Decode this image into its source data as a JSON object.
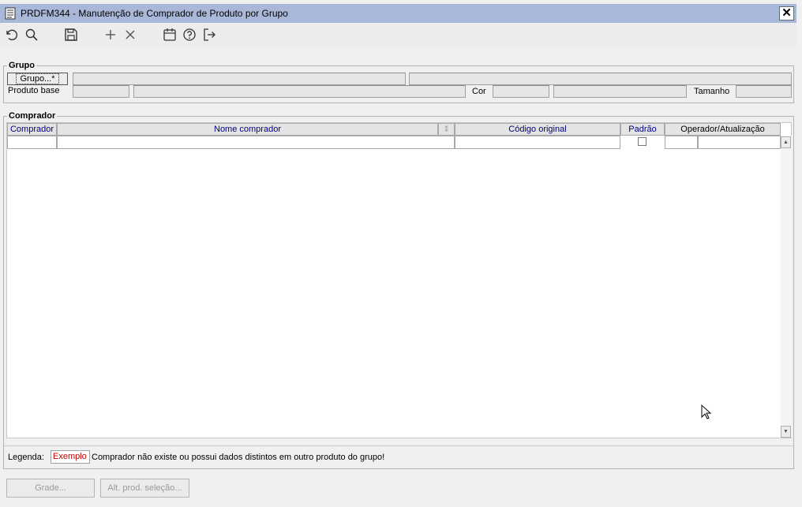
{
  "window": {
    "title": "PRDFM344 - Manutenção de Comprador de Produto por Grupo",
    "close_glyph": "✕"
  },
  "toolbar": {
    "icons": [
      "undo-icon",
      "search-icon",
      "save-icon",
      "add-icon",
      "delete-icon",
      "calendar-icon",
      "help-icon",
      "exit-icon"
    ]
  },
  "grupo": {
    "legend": "Grupo",
    "button": "Grupo...*",
    "produto_base_label": "Produto base",
    "cor_label": "Cor",
    "tamanho_label": "Tamanho"
  },
  "comprador": {
    "legend": "Comprador",
    "columns": [
      "Comprador",
      "Nome comprador",
      "Código original",
      "Padrão",
      "Operador/Atualização"
    ],
    "sort_glyph": "⁑"
  },
  "legenda": {
    "label": "Legenda:",
    "example": "Exemplo",
    "text": "Comprador não existe ou possui dados distintos em outro produto do grupo!",
    "example_color": "#c00000"
  },
  "buttons": {
    "grade": "Grade...",
    "alt": "Alt. prod. seleção..."
  },
  "colors": {
    "titlebar": "#a9b8d9",
    "header_text_blue": "#000080"
  }
}
